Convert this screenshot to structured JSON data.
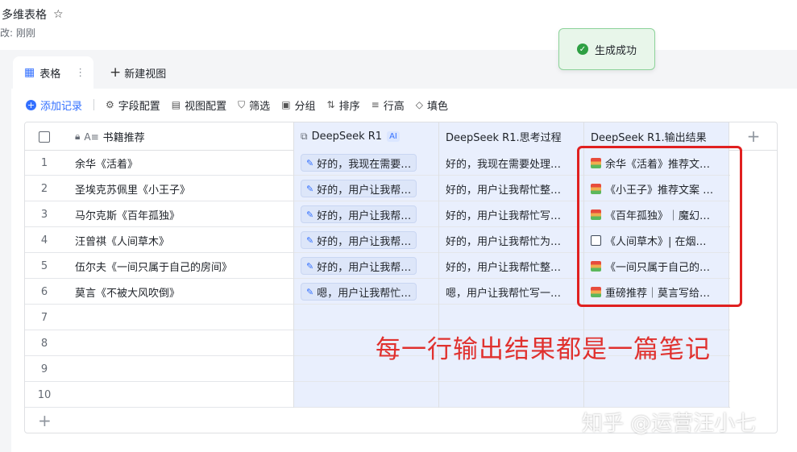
{
  "doc": {
    "title": "多维表格",
    "subtitle": "改: 刚刚"
  },
  "toast": {
    "text": "生成成功"
  },
  "tabs": [
    {
      "label": "表格"
    },
    {
      "label": "新建视图"
    }
  ],
  "toolbar": {
    "add": "添加记录",
    "fields": "字段配置",
    "view": "视图配置",
    "filter": "筛选",
    "group": "分组",
    "sort": "排序",
    "rowheight": "行高",
    "fill": "填色"
  },
  "columns": {
    "book": "书籍推荐",
    "ai": "DeepSeek R1",
    "ai_badge": "AI",
    "think": "DeepSeek R1.思考过程",
    "output": "DeepSeek R1.输出结果"
  },
  "rows": [
    {
      "num": "1",
      "book": "余华《活着》",
      "ai": "好的，我现在需要…",
      "think": "好的，我现在需要处理…",
      "output": "余华《活着》推荐文…"
    },
    {
      "num": "2",
      "book": "圣埃克苏佩里《小王子》",
      "ai": "好的，用户让我帮…",
      "think": "好的，用户让我帮忙整…",
      "output": "《小王子》推荐文案 …"
    },
    {
      "num": "3",
      "book": "马尔克斯《百年孤独》",
      "ai": "好的，用户让我帮…",
      "think": "好的，用户让我帮忙写…",
      "output": "《百年孤独》｜魔幻…"
    },
    {
      "num": "4",
      "book": "汪曾祺《人间草木》",
      "ai": "好的，用户让我帮…",
      "think": "好的，用户让我帮忙为…",
      "output": "《人间草木》| 在烟…"
    },
    {
      "num": "5",
      "book": "伍尔夫《一间只属于自己的房间》",
      "ai": "好的，用户让我帮…",
      "think": "好的，用户让我帮忙整…",
      "output": "《一间只属于自己的…"
    },
    {
      "num": "6",
      "book": "莫言《不被大风吹倒》",
      "ai": "嗯，用户让我帮忙…",
      "think": "嗯，用户让我帮忙写一…",
      "output": "重磅推荐｜莫言写给…"
    },
    {
      "num": "7",
      "book": "",
      "ai": "",
      "think": "",
      "output": ""
    },
    {
      "num": "8",
      "book": "",
      "ai": "",
      "think": "",
      "output": ""
    },
    {
      "num": "9",
      "book": "",
      "ai": "",
      "think": "",
      "output": ""
    },
    {
      "num": "10",
      "book": "",
      "ai": "",
      "think": "",
      "output": ""
    }
  ],
  "annotation": "每一行输出结果都是一篇笔记",
  "watermark": "知乎 @运营汪小七",
  "colors": {
    "accent": "#3370ff",
    "ai_column_bg": "#e9effd",
    "annotation_red": "#e02020",
    "toast_bg": "#e8f6ea"
  },
  "icons": {
    "star": "star-icon",
    "grid": "grid-table-icon",
    "more": "more-vertical-icon",
    "plus": "plus-icon",
    "check": "check-circle-icon",
    "lock": "lock-icon",
    "text_field": "text-field-icon",
    "ai_field": "ai-field-icon",
    "doc": "doc-icon"
  }
}
